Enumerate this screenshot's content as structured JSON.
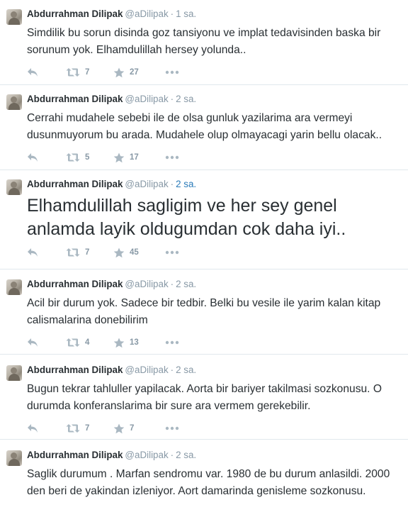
{
  "tweets": [
    {
      "fullname": "Abdurrahman Dilipak",
      "username": "@aDilipak",
      "time": "1 sa.",
      "time_active": false,
      "text": "Simdilik bu sorun disinda goz tansiyonu ve implat tedavisinden baska bir sorunum yok. Elhamdulillah hersey yolunda..",
      "big": false,
      "retweets": "7",
      "favorites": "27"
    },
    {
      "fullname": "Abdurrahman Dilipak",
      "username": "@aDilipak",
      "time": "2 sa.",
      "time_active": false,
      "text": "Cerrahi mudahele sebebi ile de olsa gunluk yazilarima ara vermeyi dusunmuyorum bu arada. Mudahele olup olmayacagi yarin bellu olacak..",
      "big": false,
      "retweets": "5",
      "favorites": "17"
    },
    {
      "fullname": "Abdurrahman Dilipak",
      "username": "@aDilipak",
      "time": "2 sa.",
      "time_active": true,
      "text": "Elhamdulillah sagligim ve her sey genel anlamda layik oldugumdan cok daha iyi..",
      "big": true,
      "retweets": "7",
      "favorites": "45"
    },
    {
      "fullname": "Abdurrahman Dilipak",
      "username": "@aDilipak",
      "time": "2 sa.",
      "time_active": false,
      "text": "Acil bir durum yok. Sadece bir tedbir. Belki bu vesile ile yarim kalan kitap calismalarina donebilirim",
      "big": false,
      "retweets": "4",
      "favorites": "13"
    },
    {
      "fullname": "Abdurrahman Dilipak",
      "username": "@aDilipak",
      "time": "2 sa.",
      "time_active": false,
      "text": "Bugun tekrar tahluller yapilacak. Aorta bir bariyer takilmasi sozkonusu. O durumda konferanslarima bir sure ara vermem gerekebilir.",
      "big": false,
      "retweets": "7",
      "favorites": "7"
    },
    {
      "fullname": "Abdurrahman Dilipak",
      "username": "@aDilipak",
      "time": "2 sa.",
      "time_active": false,
      "text": "Saglik durumum . Marfan sendromu var. 1980 de bu durum anlasildi. 2000 den beri de yakindan izleniyor. Aort damarinda genisleme sozkonusu.",
      "big": false,
      "retweets": "",
      "favorites": ""
    }
  ],
  "icons": {
    "reply": "reply-icon",
    "retweet": "retweet-icon",
    "favorite": "star-icon",
    "more": "more-icon"
  },
  "colors": {
    "name": "#292f33",
    "meta": "#8899a6",
    "active_time": "#2b7bb9",
    "action_icon": "#aab8c2",
    "divider": "#e1e8ed"
  },
  "separator": "·"
}
